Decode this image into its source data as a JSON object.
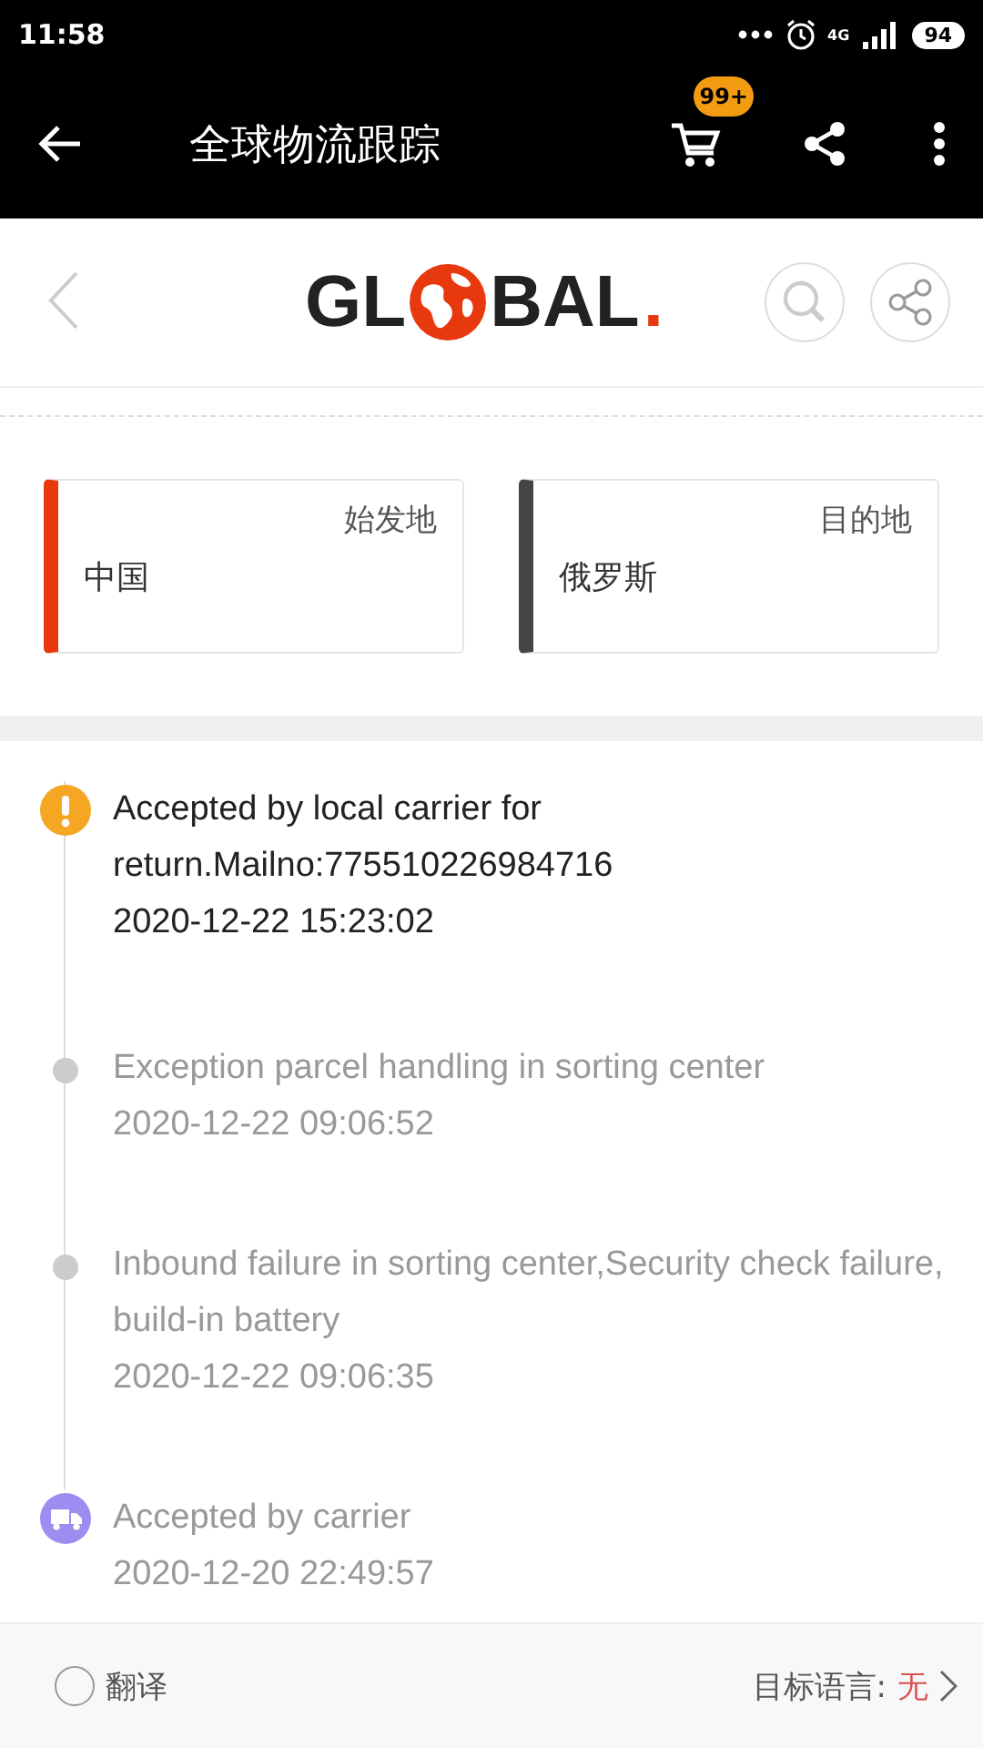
{
  "status_bar": {
    "time": "11:58",
    "network": "4G",
    "battery": "94"
  },
  "app_bar": {
    "title": "全球物流跟踪",
    "cart_badge": "99+"
  },
  "logo": {
    "left": "GL",
    "right": "BAL",
    "dot": "."
  },
  "route": [
    {
      "label": "始发地",
      "value": "中国",
      "color": "#e8380d"
    },
    {
      "label": "目的地",
      "value": "俄罗斯",
      "color": "#444444"
    }
  ],
  "events": [
    {
      "kind": "exception",
      "text": "Accepted by local carrier for return.Mailno:775510226984716",
      "time": "2020-12-22 15:23:02",
      "current": true
    },
    {
      "kind": "dot",
      "text": "Exception parcel handling in sorting center",
      "time": "2020-12-22 09:06:52",
      "current": false
    },
    {
      "kind": "dot",
      "text": "Inbound failure in sorting center,Security check failure, build-in battery",
      "time": "2020-12-22 09:06:35",
      "current": false
    },
    {
      "kind": "truck",
      "text": "Accepted by carrier",
      "time": "2020-12-20 22:49:57",
      "current": false
    }
  ],
  "translate": {
    "label": "翻译",
    "checked": false,
    "target_label": "目标语言:",
    "target_value": "无"
  }
}
